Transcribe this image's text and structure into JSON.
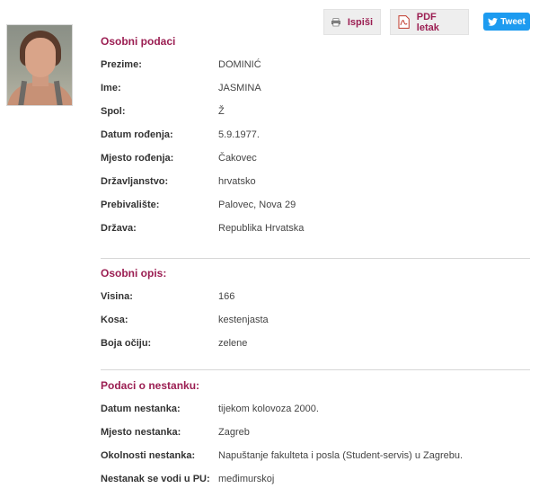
{
  "toolbar": {
    "print_label": "Ispiši",
    "pdf_label": "PDF letak",
    "tweet_label": "Tweet"
  },
  "photo": {
    "icon": "person-photo"
  },
  "personal": {
    "title": "Osobni podaci",
    "rows": [
      {
        "label": "Prezime:",
        "value": "DOMINIĆ"
      },
      {
        "label": "Ime:",
        "value": "JASMINA"
      },
      {
        "label": "Spol:",
        "value": "Ž"
      },
      {
        "label": "Datum rođenja:",
        "value": "5.9.1977."
      },
      {
        "label": "Mjesto rođenja:",
        "value": "Čakovec"
      },
      {
        "label": "Državljanstvo:",
        "value": "hrvatsko"
      },
      {
        "label": "Prebivalište:",
        "value": "Palovec, Nova 29"
      },
      {
        "label": "Država:",
        "value": "Republika Hrvatska"
      }
    ]
  },
  "description": {
    "title": "Osobni opis:",
    "rows": [
      {
        "label": "Visina:",
        "value": "166"
      },
      {
        "label": "Kosa:",
        "value": "kestenjasta"
      },
      {
        "label": "Boja očiju:",
        "value": "zelene"
      }
    ]
  },
  "disappearance": {
    "title": "Podaci o nestanku:",
    "rows": [
      {
        "label": "Datum nestanka:",
        "value": "tijekom kolovoza 2000."
      },
      {
        "label": "Mjesto nestanka:",
        "value": "Zagreb"
      },
      {
        "label": "Okolnosti nestanka:",
        "value": "Napuštanje fakulteta i posla (Student-servis) u Zagrebu."
      },
      {
        "label": "Nestanak se vodi u PU:",
        "value": "međimurskoj"
      }
    ]
  },
  "colors": {
    "accent": "#9b1e52",
    "tweet": "#1d9bf0"
  }
}
